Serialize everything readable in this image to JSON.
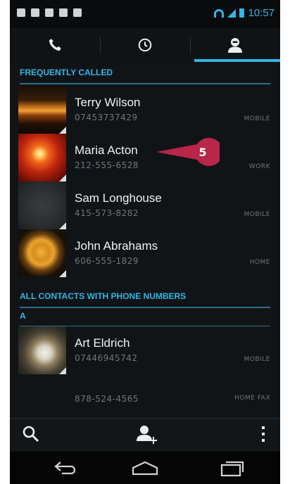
{
  "status_bar": {
    "time": "10:57",
    "notification_icons": [
      "chat-icon",
      "mail-icon",
      "voicemail-icon",
      "bag-icon",
      "bag-icon"
    ],
    "system_icons": [
      "wifi-icon",
      "signal-icon",
      "battery-icon"
    ]
  },
  "tabs": [
    {
      "name": "phone",
      "icon": "phone-icon",
      "active": false
    },
    {
      "name": "recent",
      "icon": "clock-icon",
      "active": false
    },
    {
      "name": "contacts",
      "icon": "person-icon",
      "active": true
    }
  ],
  "sections": {
    "frequently_called": "FREQUENTLY CALLED",
    "all_contacts": "ALL CONTACTS WITH PHONE NUMBERS",
    "letter_a": "A"
  },
  "frequent_contacts": [
    {
      "name": "Terry Wilson",
      "number": "07453737429",
      "type": "MOBILE"
    },
    {
      "name": "Maria Acton",
      "number": "212-555-6528",
      "type": "WORK"
    },
    {
      "name": "Sam Longhouse",
      "number": "415-573-8282",
      "type": "MOBILE"
    },
    {
      "name": "John Abrahams",
      "number": "606-555-1829",
      "type": "HOME"
    }
  ],
  "all_contacts": [
    {
      "name": "Art Eldrich",
      "number": "07446945742",
      "type": "MOBILE"
    }
  ],
  "extra_numbers": [
    {
      "number": "878-524-4565",
      "type": "HOME FAX"
    }
  ],
  "callout_badge": "5",
  "colors": {
    "accent": "#33b5e5",
    "callout": "#b8264a",
    "background": "#111417"
  },
  "action_bar": {
    "icons": [
      "search-icon",
      "add-contact-icon",
      "overflow-menu-icon"
    ]
  },
  "nav_bar": {
    "icons": [
      "back-icon",
      "home-icon",
      "recent-apps-icon"
    ]
  }
}
